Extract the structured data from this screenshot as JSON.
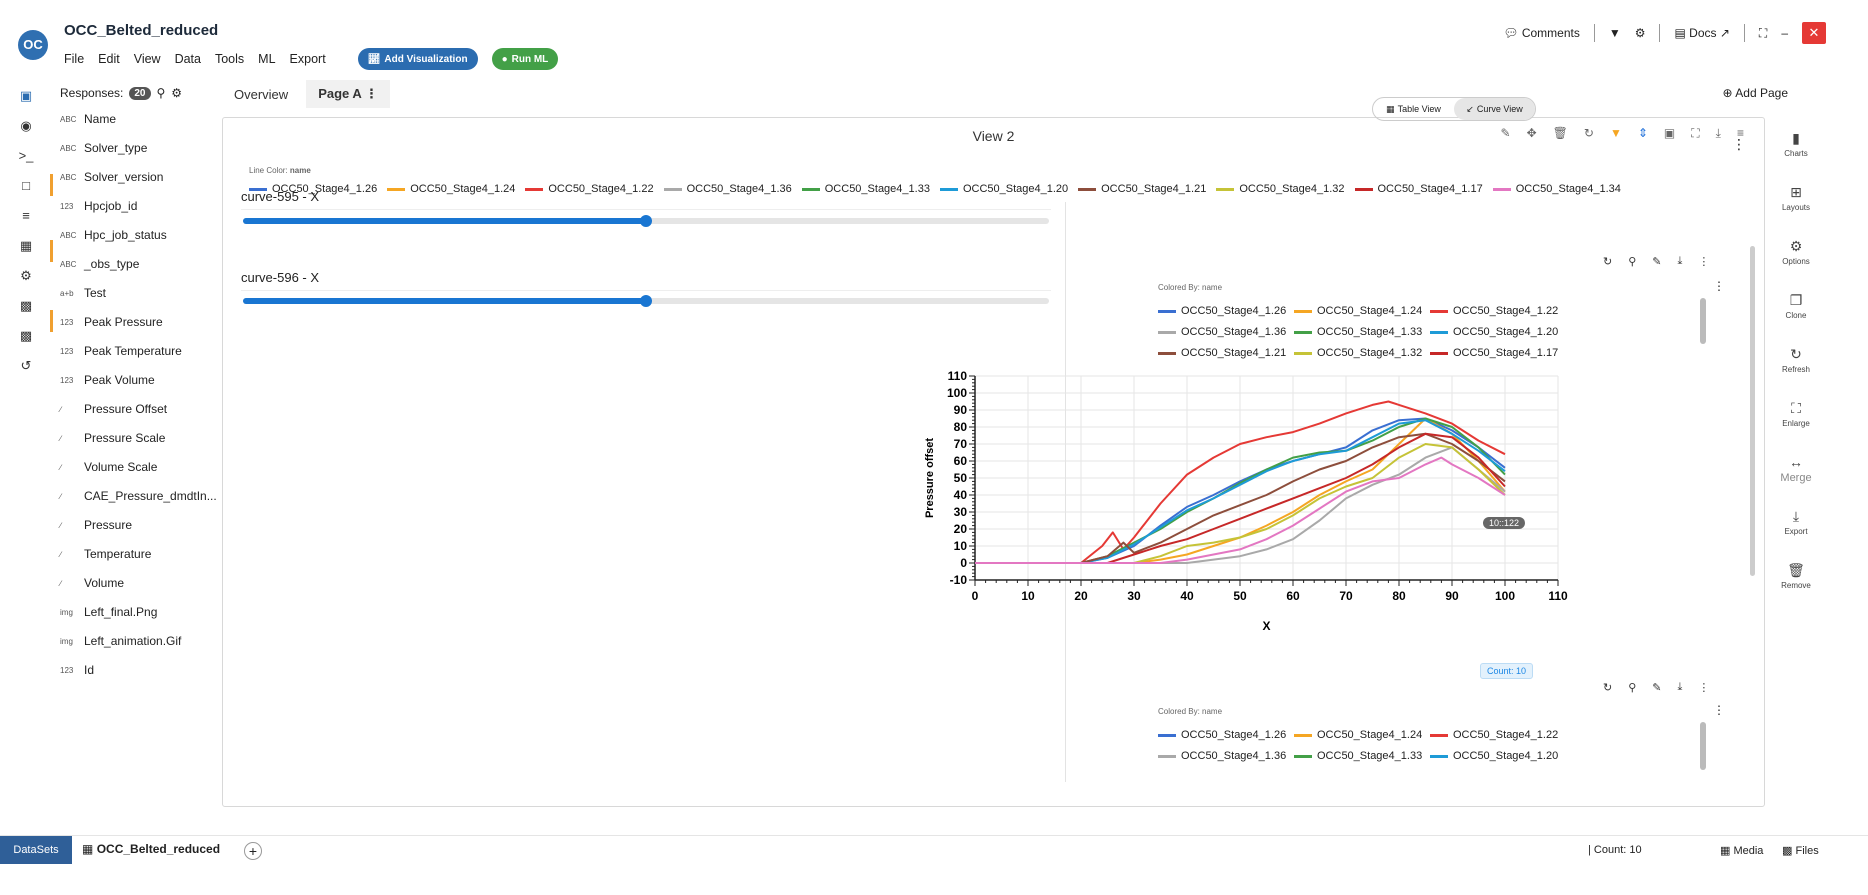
{
  "app": {
    "title": "OCC_Belted_reduced",
    "logo_text": "OC"
  },
  "menu": [
    "File",
    "Edit",
    "View",
    "Data",
    "Tools",
    "ML",
    "Export"
  ],
  "buttons": {
    "add_visualization": "Add Visualization",
    "run_ml": "Run ML"
  },
  "top_right": {
    "comments": "Comments",
    "docs": "Docs"
  },
  "fields_panel": {
    "header": "Responses:",
    "count": "20",
    "fields": [
      {
        "type": "ABC",
        "name": "Name"
      },
      {
        "type": "ABC",
        "name": "Solver_type"
      },
      {
        "type": "ABC",
        "name": "Solver_version"
      },
      {
        "type": "123",
        "name": "Hpcjob_id"
      },
      {
        "type": "ABC",
        "name": "Hpc_job_status"
      },
      {
        "type": "ABC",
        "name": "_obs_type"
      },
      {
        "type": "a+b",
        "name": "Test"
      },
      {
        "type": "123",
        "name": "Peak Pressure"
      },
      {
        "type": "123",
        "name": "Peak Temperature"
      },
      {
        "type": "123",
        "name": "Peak Volume"
      },
      {
        "type": "∕",
        "name": "Pressure Offset"
      },
      {
        "type": "∕",
        "name": "Pressure Scale"
      },
      {
        "type": "∕",
        "name": "Volume Scale"
      },
      {
        "type": "∕",
        "name": "CAE_Pressure_dmdtIn..."
      },
      {
        "type": "∕",
        "name": "Pressure"
      },
      {
        "type": "∕",
        "name": "Temperature"
      },
      {
        "type": "∕",
        "name": "Volume"
      },
      {
        "type": "img",
        "name": "Left_final.Png"
      },
      {
        "type": "img",
        "name": "Left_animation.Gif"
      },
      {
        "type": "123",
        "name": "Id"
      }
    ]
  },
  "tabs": {
    "overview": "Overview",
    "page_a": "Page A",
    "add_page": "Add Page"
  },
  "view": {
    "title": "View 2",
    "line_color_label": "Line Color:",
    "line_color_field": "name",
    "sliders": [
      {
        "label": "curve-595 - X",
        "level": 0.5
      },
      {
        "label": "curve-596 - X",
        "level": 0.5
      }
    ],
    "toggle": {
      "table": "Table View",
      "curve": "Curve View"
    },
    "colored_by": "Colored By: name",
    "count_badge": "10::122",
    "count_tag": "Count: 10"
  },
  "series_colors": {
    "OCC50_Stage4_1.26": "#3a6fd1",
    "OCC50_Stage4_1.24": "#f5a623",
    "OCC50_Stage4_1.22": "#e53935",
    "OCC50_Stage4_1.36": "#a9a9a9",
    "OCC50_Stage4_1.33": "#43a047",
    "OCC50_Stage4_1.20": "#1e9bd7",
    "OCC50_Stage4_1.21": "#8d4e3c",
    "OCC50_Stage4_1.32": "#c5c337",
    "OCC50_Stage4_1.17": "#c62828",
    "OCC50_Stage4_1.34": "#e377c2"
  },
  "legend_main": [
    "OCC50_Stage4_1.26",
    "OCC50_Stage4_1.24",
    "OCC50_Stage4_1.22",
    "OCC50_Stage4_1.36",
    "OCC50_Stage4_1.33",
    "OCC50_Stage4_1.20",
    "OCC50_Stage4_1.21",
    "OCC50_Stage4_1.32",
    "OCC50_Stage4_1.17",
    "OCC50_Stage4_1.34"
  ],
  "legend_chart1": [
    "OCC50_Stage4_1.26",
    "OCC50_Stage4_1.24",
    "OCC50_Stage4_1.22",
    "OCC50_Stage4_1.36",
    "OCC50_Stage4_1.33",
    "OCC50_Stage4_1.20",
    "OCC50_Stage4_1.21",
    "OCC50_Stage4_1.32",
    "OCC50_Stage4_1.17"
  ],
  "legend_chart2": [
    "OCC50_Stage4_1.26",
    "OCC50_Stage4_1.24",
    "OCC50_Stage4_1.22",
    "OCC50_Stage4_1.36",
    "OCC50_Stage4_1.33",
    "OCC50_Stage4_1.20"
  ],
  "right_rail": [
    "Charts",
    "Layouts",
    "Options",
    "Clone",
    "Refresh",
    "Enlarge",
    "Merge",
    "Export",
    "Remove"
  ],
  "bottom": {
    "datasets": "DataSets",
    "dataset_tab": "OCC_Belted_reduced",
    "count": "Count: 10",
    "media": "Media",
    "files": "Files"
  },
  "chart_data": {
    "type": "line",
    "xlabel": "X",
    "ylabel": "Pressure offset",
    "xlim": [
      0,
      110
    ],
    "ylim": [
      -10,
      110
    ],
    "xticks": [
      0,
      10,
      20,
      30,
      40,
      50,
      60,
      70,
      80,
      90,
      100,
      110
    ],
    "yticks": [
      -10,
      0,
      10,
      20,
      30,
      40,
      50,
      60,
      70,
      80,
      90,
      100,
      110
    ],
    "grid": true,
    "series": [
      {
        "name": "OCC50_Stage4_1.26",
        "x": [
          0,
          20,
          25,
          30,
          35,
          40,
          45,
          50,
          55,
          60,
          65,
          70,
          75,
          80,
          85,
          90,
          95,
          100
        ],
        "y": [
          0,
          0,
          3,
          10,
          22,
          33,
          40,
          48,
          55,
          60,
          64,
          68,
          78,
          84,
          85,
          78,
          68,
          56
        ]
      },
      {
        "name": "OCC50_Stage4_1.24",
        "x": [
          0,
          30,
          35,
          40,
          45,
          50,
          55,
          60,
          65,
          70,
          75,
          80,
          85,
          90,
          95,
          100
        ],
        "y": [
          0,
          0,
          2,
          5,
          10,
          15,
          22,
          30,
          40,
          48,
          55,
          70,
          85,
          76,
          60,
          42
        ]
      },
      {
        "name": "OCC50_Stage4_1.22",
        "x": [
          0,
          20,
          24,
          26,
          28,
          30,
          35,
          40,
          45,
          50,
          55,
          60,
          65,
          70,
          75,
          78,
          80,
          85,
          90,
          95,
          100
        ],
        "y": [
          0,
          0,
          10,
          18,
          8,
          15,
          35,
          52,
          62,
          70,
          74,
          77,
          82,
          88,
          93,
          95,
          93,
          88,
          82,
          72,
          64
        ]
      },
      {
        "name": "OCC50_Stage4_1.36",
        "x": [
          0,
          40,
          45,
          50,
          55,
          60,
          65,
          70,
          75,
          80,
          85,
          90,
          95,
          100
        ],
        "y": [
          0,
          0,
          2,
          4,
          8,
          14,
          25,
          38,
          46,
          52,
          62,
          68,
          55,
          42
        ]
      },
      {
        "name": "OCC50_Stage4_1.33",
        "x": [
          0,
          20,
          25,
          30,
          35,
          40,
          45,
          50,
          55,
          60,
          65,
          70,
          75,
          80,
          85,
          90,
          95,
          100
        ],
        "y": [
          0,
          0,
          4,
          12,
          20,
          30,
          38,
          47,
          55,
          62,
          65,
          66,
          72,
          80,
          85,
          80,
          68,
          52
        ]
      },
      {
        "name": "OCC50_Stage4_1.20",
        "x": [
          0,
          20,
          25,
          30,
          35,
          40,
          45,
          50,
          55,
          60,
          65,
          70,
          75,
          80,
          85,
          90,
          95,
          100
        ],
        "y": [
          0,
          0,
          3,
          11,
          21,
          31,
          38,
          46,
          54,
          60,
          64,
          66,
          74,
          82,
          84,
          76,
          66,
          54
        ]
      },
      {
        "name": "OCC50_Stage4_1.21",
        "x": [
          0,
          20,
          25,
          28,
          30,
          35,
          40,
          45,
          50,
          55,
          60,
          65,
          70,
          75,
          80,
          85,
          90,
          95,
          100
        ],
        "y": [
          0,
          0,
          4,
          12,
          6,
          12,
          20,
          28,
          34,
          40,
          48,
          55,
          60,
          68,
          74,
          76,
          70,
          60,
          48
        ]
      },
      {
        "name": "OCC50_Stage4_1.32",
        "x": [
          0,
          30,
          35,
          40,
          45,
          50,
          55,
          60,
          65,
          70,
          75,
          80,
          85,
          90,
          95,
          100
        ],
        "y": [
          0,
          0,
          4,
          10,
          12,
          15,
          20,
          28,
          38,
          45,
          50,
          62,
          70,
          68,
          55,
          40
        ]
      },
      {
        "name": "OCC50_Stage4_1.17",
        "x": [
          0,
          25,
          30,
          35,
          40,
          45,
          50,
          55,
          60,
          65,
          70,
          75,
          80,
          85,
          90,
          95,
          100
        ],
        "y": [
          0,
          0,
          5,
          10,
          14,
          20,
          26,
          32,
          38,
          44,
          50,
          58,
          68,
          76,
          74,
          62,
          45
        ]
      },
      {
        "name": "OCC50_Stage4_1.34",
        "x": [
          0,
          35,
          40,
          45,
          50,
          55,
          60,
          65,
          70,
          75,
          80,
          85,
          88,
          90,
          95,
          100
        ],
        "y": [
          0,
          0,
          2,
          5,
          8,
          14,
          22,
          32,
          42,
          48,
          50,
          58,
          62,
          58,
          50,
          40
        ]
      }
    ]
  }
}
